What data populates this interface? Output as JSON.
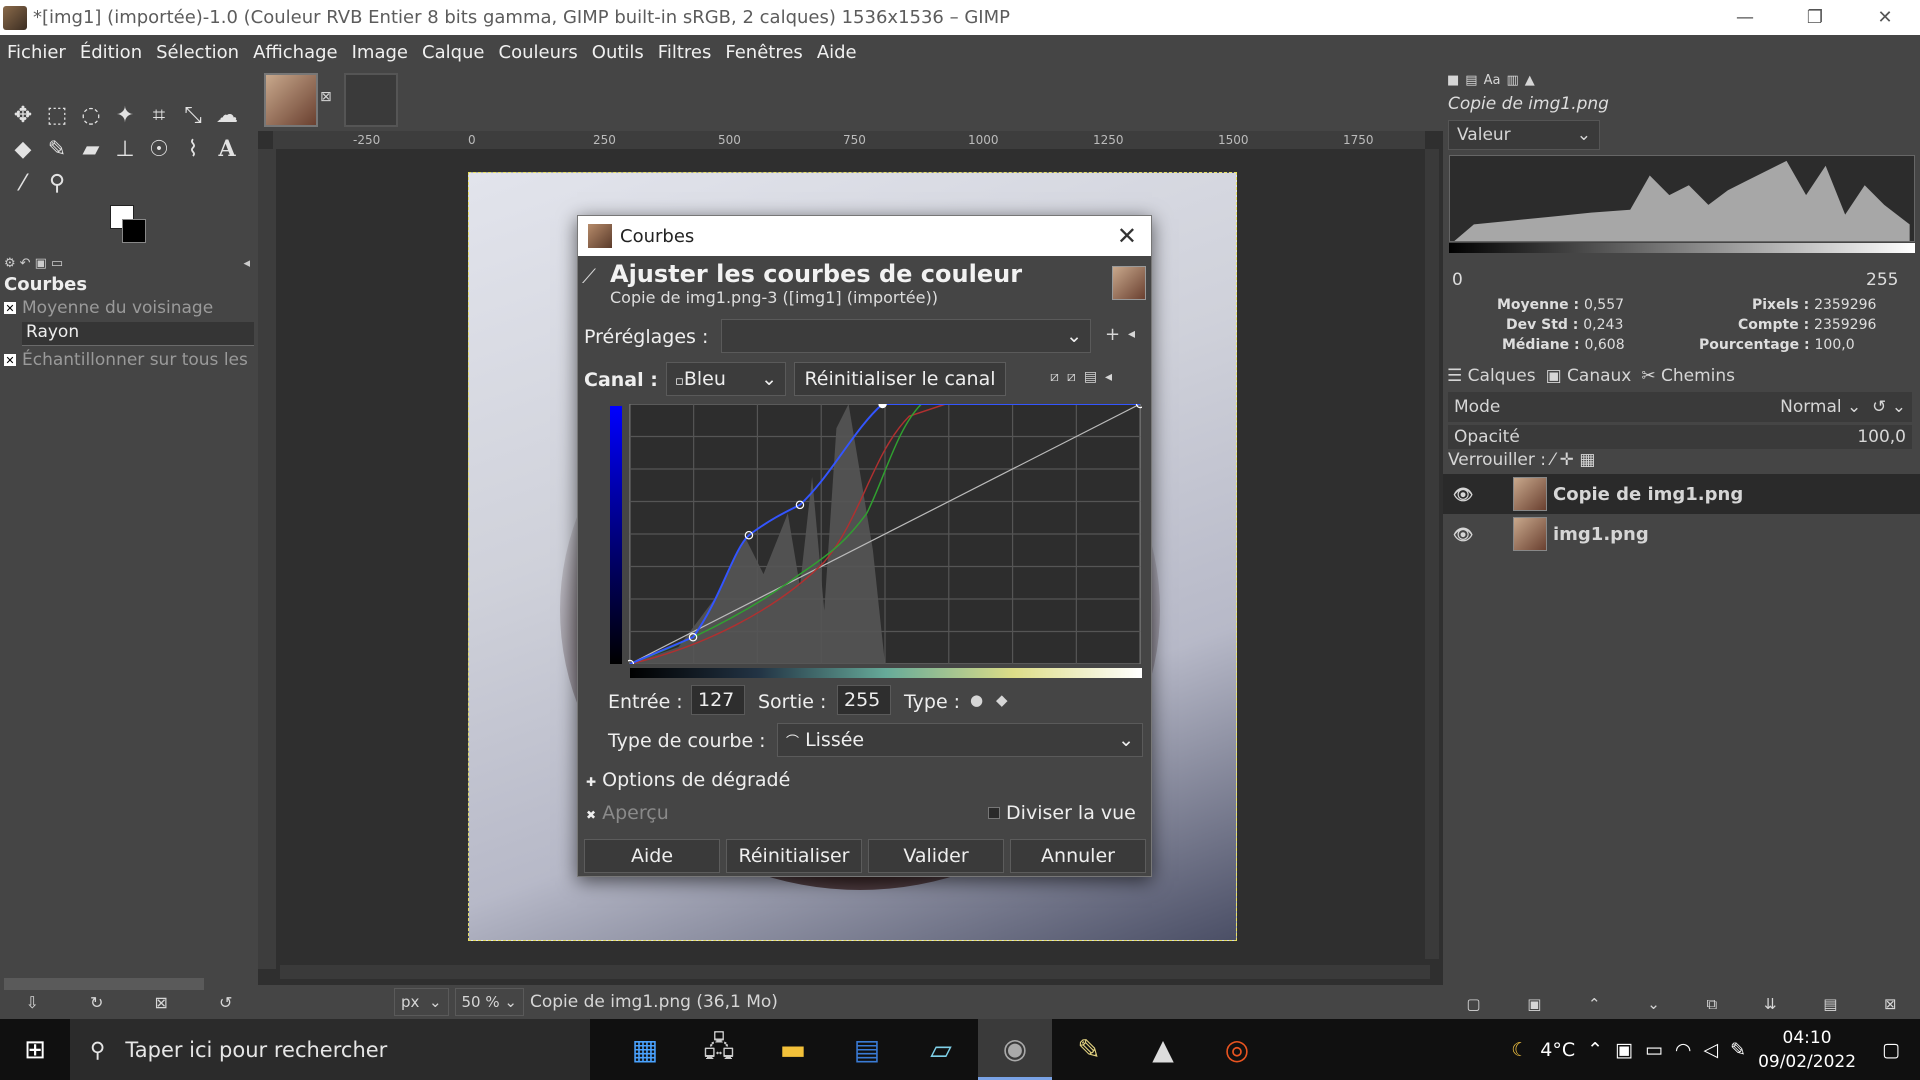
{
  "window": {
    "title": "*[img1] (importée)-1.0 (Couleur RVB Entier 8 bits gamma, GIMP built-in sRGB, 2 calques) 1536x1536 – GIMP"
  },
  "menu": [
    "Fichier",
    "Édition",
    "Sélection",
    "Affichage",
    "Image",
    "Calque",
    "Couleurs",
    "Outils",
    "Filtres",
    "Fenêtres",
    "Aide"
  ],
  "tool_options": {
    "title": "Courbes",
    "option1": "Moyenne du voisinage",
    "rayon": "Rayon",
    "option2": "Échantillonner sur tous les"
  },
  "ruler": {
    "labels": [
      "-250",
      "0",
      "250",
      "500",
      "750",
      "1000",
      "1250",
      "1500",
      "1750"
    ]
  },
  "statusbar": {
    "unit": "px",
    "zoom": "50 %",
    "info": "Copie de img1.png (36,1 Mo)"
  },
  "histogram": {
    "layer_name": "Copie de img1.png",
    "channel": "Valeur",
    "range_min": "0",
    "range_max": "255",
    "moyenne_label": "Moyenne :",
    "moyenne": "0,557",
    "devstd_label": "Dev Std :",
    "devstd": "0,243",
    "mediane_label": "Médiane :",
    "mediane": "0,608",
    "pixels_label": "Pixels :",
    "pixels": "2359296",
    "compte_label": "Compte :",
    "compte": "2359296",
    "pourcentage_label": "Pourcentage :",
    "pourcentage": "100,0"
  },
  "layers_panel": {
    "tabs": [
      "Calques",
      "Canaux",
      "Chemins"
    ],
    "mode_label": "Mode",
    "mode_value": "Normal",
    "opacity_label": "Opacité",
    "opacity_value": "100,0",
    "lock_label": "Verrouiller :",
    "layers": [
      "Copie de img1.png",
      "img1.png"
    ]
  },
  "dialog": {
    "title": "Courbes",
    "heading": "Ajuster les courbes de couleur",
    "subtitle": "Copie de img1.png-3 ([img1] (importée))",
    "presets_label": "Préréglages :",
    "channel_label": "Canal :",
    "channel_value": "Bleu",
    "reset_channel": "Réinitialiser le canal",
    "input_label": "Entrée :",
    "input_value": "127",
    "output_label": "Sortie :",
    "output_value": "255",
    "type_label": "Type :",
    "curve_type_label": "Type de courbe :",
    "curve_type_value": "Lissée",
    "gradient_options": "Options de dégradé",
    "preview": "Aperçu",
    "split_view": "Diviser la vue",
    "buttons": {
      "help": "Aide",
      "reset": "Réinitialiser",
      "ok": "Valider",
      "cancel": "Annuler"
    }
  },
  "taskbar": {
    "search_placeholder": "Taper ici pour rechercher",
    "temperature": "4°C",
    "time": "04:10",
    "date": "09/02/2022"
  }
}
